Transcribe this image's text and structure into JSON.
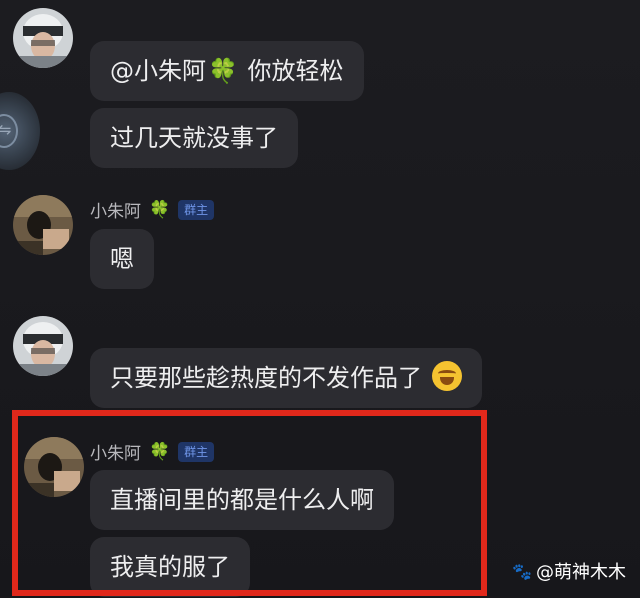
{
  "chat": {
    "messages": [
      {
        "text": "过几天就没事了"
      },
      {
        "sender": "小朱阿",
        "badge": "群主",
        "text": "嗯"
      },
      {
        "text": "只要那些趁热度的不发作品了"
      },
      {
        "sender": "小朱阿",
        "badge": "群主",
        "texts": [
          "直播间里的都是什么人啊",
          "我真的服了"
        ]
      }
    ],
    "mention_message": {
      "mention": "@小朱阿",
      "clover": "🍀",
      "rest": " 你放轻松"
    }
  },
  "watermark": {
    "paw": "🐾",
    "text": "@萌神木木"
  },
  "colors": {
    "highlight": "#e0281b",
    "badge_bg": "#1f3566",
    "badge_text": "#6f95e8",
    "bubble": "#2c2c31"
  }
}
